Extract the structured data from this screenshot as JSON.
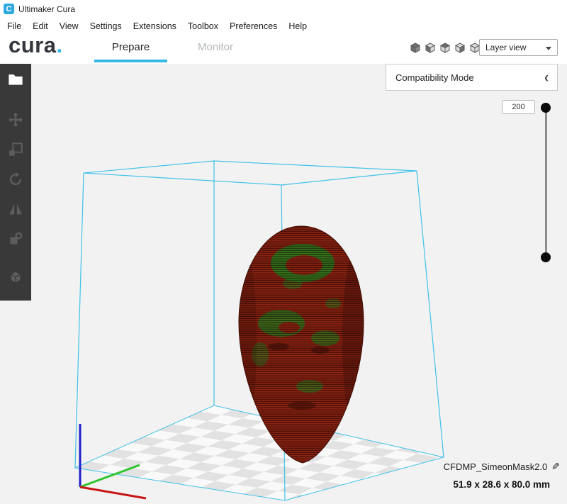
{
  "window": {
    "title": "Ultimaker Cura",
    "logo_letter": "C"
  },
  "menu_bar": {
    "items": [
      "File",
      "Edit",
      "View",
      "Settings",
      "Extensions",
      "Toolbox",
      "Preferences",
      "Help"
    ]
  },
  "header": {
    "brand": "cura",
    "brand_dot": ".",
    "tabs": {
      "prepare": "Prepare",
      "monitor": "Monitor"
    },
    "view_buttons": [
      "view-3d-icon",
      "view-front-icon",
      "view-top-icon",
      "view-left-icon",
      "view-right-icon"
    ],
    "view_mode": {
      "value": "Layer view"
    }
  },
  "panels": {
    "compatibility": {
      "label": "Compatibility Mode",
      "collapse_glyph": "‹"
    }
  },
  "layer_slider": {
    "top_value": "200"
  },
  "toolbar": {
    "items": [
      "open-file-icon",
      "move-icon",
      "scale-icon",
      "rotate-icon",
      "mirror-icon",
      "per-model-settings-icon",
      "support-blocker-icon"
    ]
  },
  "model_info": {
    "name": "CFDMP_SimeonMask2.0",
    "edit_glyph": "✎",
    "dimensions": "51.9 x 28.6 x 80.0 mm"
  },
  "colors": {
    "accent": "#35b9e5",
    "build_volume": "#41c2e8",
    "layer_shell_red": "#8a2312",
    "layer_infill_green": "#2e7a1c",
    "axis_x_red": "#c81414",
    "axis_y_green": "#2fc42f",
    "axis_z_blue": "#2020c8"
  }
}
